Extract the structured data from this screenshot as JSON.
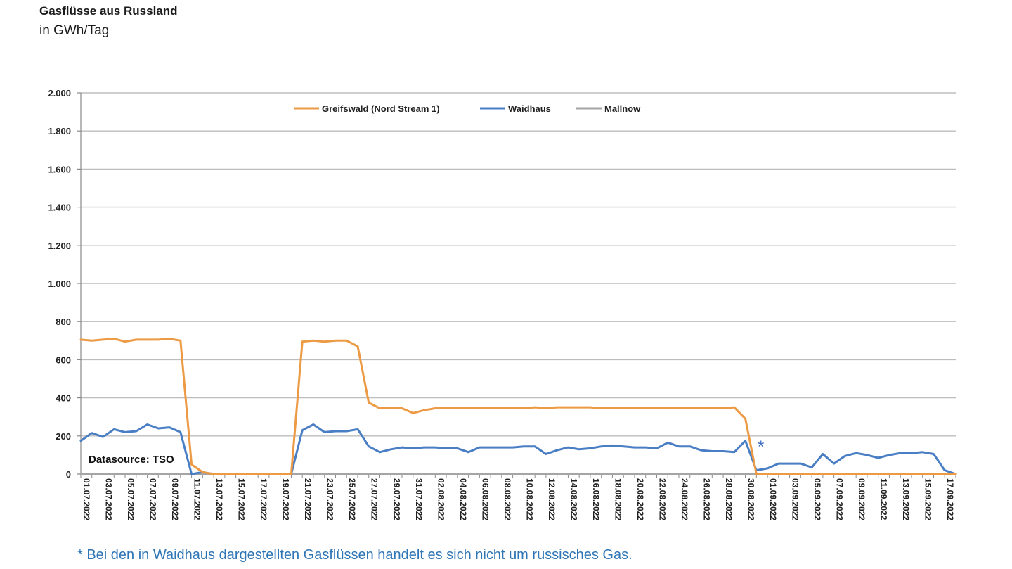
{
  "header": {
    "title": "Gasflüsse aus Russland",
    "unit": "in GWh/Tag"
  },
  "footnote": "* Bei den in Waidhaus dargestellten Gasflüssen handelt es sich nicht um russisches Gas.",
  "source_label": "Datasource: TSO",
  "annotation_star": "*",
  "colors": {
    "greifswald": "#ed9a45",
    "waidhaus": "#4a7ec4",
    "mallnow": "#a5a5a5",
    "grid": "#bdbdbd",
    "footnote": "#2e75b6"
  },
  "chart_data": {
    "type": "line",
    "title": "Gasflüsse aus Russland",
    "ylabel": "in GWh/Tag",
    "ylim": [
      0,
      2000
    ],
    "yticks": [
      "2.000",
      "1.800",
      "1.600",
      "1.400",
      "1.200",
      "1.000",
      "800",
      "600",
      "400",
      "200",
      "0"
    ],
    "ytick_values": [
      2000,
      1800,
      1600,
      1400,
      1200,
      1000,
      800,
      600,
      400,
      200,
      0
    ],
    "grid": true,
    "legend_position": "top-center",
    "x": [
      "01.07.2022",
      "02.07.2022",
      "03.07.2022",
      "04.07.2022",
      "05.07.2022",
      "06.07.2022",
      "07.07.2022",
      "08.07.2022",
      "09.07.2022",
      "10.07.2022",
      "11.07.2022",
      "12.07.2022",
      "13.07.2022",
      "14.07.2022",
      "15.07.2022",
      "16.07.2022",
      "17.07.2022",
      "18.07.2022",
      "19.07.2022",
      "20.07.2022",
      "21.07.2022",
      "22.07.2022",
      "23.07.2022",
      "24.07.2022",
      "25.07.2022",
      "26.07.2022",
      "27.07.2022",
      "28.07.2022",
      "29.07.2022",
      "30.07.2022",
      "31.07.2022",
      "01.08.2022",
      "02.08.2022",
      "03.08.2022",
      "04.08.2022",
      "05.08.2022",
      "06.08.2022",
      "07.08.2022",
      "08.08.2022",
      "09.08.2022",
      "10.08.2022",
      "11.08.2022",
      "12.08.2022",
      "13.08.2022",
      "14.08.2022",
      "15.08.2022",
      "16.08.2022",
      "17.08.2022",
      "18.08.2022",
      "19.08.2022",
      "20.08.2022",
      "21.08.2022",
      "22.08.2022",
      "23.08.2022",
      "24.08.2022",
      "25.08.2022",
      "26.08.2022",
      "27.08.2022",
      "28.08.2022",
      "29.08.2022",
      "30.08.2022",
      "31.08.2022",
      "01.09.2022",
      "02.09.2022",
      "03.09.2022",
      "04.09.2022",
      "05.09.2022",
      "06.09.2022",
      "07.09.2022",
      "08.09.2022",
      "09.09.2022",
      "10.09.2022",
      "11.09.2022",
      "12.09.2022",
      "13.09.2022",
      "14.09.2022",
      "15.09.2022",
      "16.09.2022",
      "17.09.2022",
      "18.09.2022"
    ],
    "xtick_labels": [
      "01.07.2022",
      "03.07.2022",
      "05.07.2022",
      "07.07.2022",
      "09.07.2022",
      "11.07.2022",
      "13.07.2022",
      "15.07.2022",
      "17.07.2022",
      "19.07.2022",
      "21.07.2022",
      "23.07.2022",
      "25.07.2022",
      "27.07.2022",
      "29.07.2022",
      "31.07.2022",
      "02.08.2022",
      "04.08.2022",
      "06.08.2022",
      "08.08.2022",
      "10.08.2022",
      "12.08.2022",
      "14.08.2022",
      "16.08.2022",
      "18.08.2022",
      "20.08.2022",
      "22.08.2022",
      "24.08.2022",
      "26.08.2022",
      "28.08.2022",
      "30.08.2022",
      "01.09.2022",
      "03.09.2022",
      "05.09.2022",
      "07.09.2022",
      "09.09.2022",
      "11.09.2022",
      "13.09.2022",
      "15.09.2022",
      "17.09.2022"
    ],
    "series": [
      {
        "name": "Greifswald (Nord Stream 1)",
        "color": "#ed9a45",
        "values": [
          705,
          700,
          705,
          710,
          695,
          705,
          705,
          705,
          710,
          700,
          50,
          10,
          0,
          0,
          0,
          0,
          0,
          0,
          0,
          0,
          695,
          700,
          695,
          700,
          700,
          670,
          375,
          345,
          345,
          345,
          320,
          335,
          345,
          345,
          345,
          345,
          345,
          345,
          345,
          345,
          345,
          350,
          345,
          350,
          350,
          350,
          350,
          345,
          345,
          345,
          345,
          345,
          345,
          345,
          345,
          345,
          345,
          345,
          345,
          350,
          290,
          0,
          0,
          0,
          0,
          0,
          0,
          0,
          0,
          0,
          0,
          0,
          0,
          0,
          0,
          0,
          0,
          0,
          0,
          0
        ]
      },
      {
        "name": "Waidhaus",
        "color": "#4a7ec4",
        "values": [
          175,
          215,
          195,
          235,
          220,
          225,
          260,
          240,
          245,
          220,
          0,
          10,
          0,
          0,
          0,
          0,
          0,
          0,
          0,
          0,
          230,
          260,
          220,
          225,
          225,
          235,
          145,
          115,
          130,
          140,
          135,
          140,
          140,
          135,
          135,
          115,
          140,
          140,
          140,
          140,
          145,
          145,
          105,
          125,
          140,
          130,
          135,
          145,
          150,
          145,
          140,
          140,
          135,
          165,
          145,
          145,
          125,
          120,
          120,
          115,
          175,
          20,
          30,
          55,
          55,
          55,
          35,
          105,
          55,
          95,
          110,
          100,
          85,
          100,
          110,
          110,
          115,
          105,
          20,
          0
        ]
      },
      {
        "name": "Mallnow",
        "color": "#a5a5a5",
        "values": [
          0,
          0,
          0,
          0,
          0,
          0,
          0,
          0,
          0,
          0,
          0,
          0,
          0,
          0,
          0,
          0,
          0,
          0,
          0,
          0,
          0,
          0,
          0,
          0,
          0,
          0,
          0,
          0,
          0,
          0,
          0,
          0,
          0,
          0,
          0,
          0,
          0,
          0,
          0,
          0,
          0,
          0,
          0,
          0,
          0,
          0,
          0,
          0,
          0,
          0,
          0,
          0,
          0,
          0,
          0,
          0,
          0,
          0,
          0,
          0,
          0,
          0,
          0,
          0,
          0,
          0,
          0,
          0,
          0,
          0,
          0,
          0,
          0,
          0,
          0,
          0,
          0,
          0,
          0,
          0
        ]
      }
    ]
  }
}
